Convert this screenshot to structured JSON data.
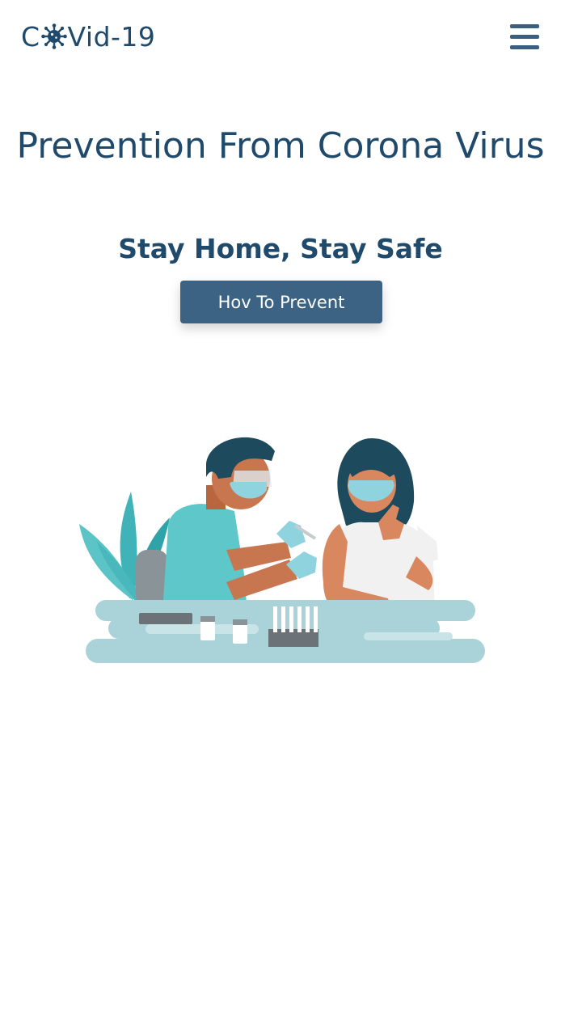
{
  "navbar": {
    "logo_prefix": "C",
    "logo_suffix": "Vid-19",
    "logo_icon": "coronavirus-icon",
    "menu_icon": "hamburger-menu-icon"
  },
  "hero": {
    "title": "Prevention From Corona Virus",
    "subtitle": "Stay Home, Stay Safe",
    "cta_label": "Hov To Prevent"
  },
  "colors": {
    "primary_text": "#1f4a6b",
    "button_bg": "#3c6384",
    "accent_teal": "#3fb3b8",
    "mask_blue": "#8fd3df",
    "table": "#a9d3d8"
  }
}
